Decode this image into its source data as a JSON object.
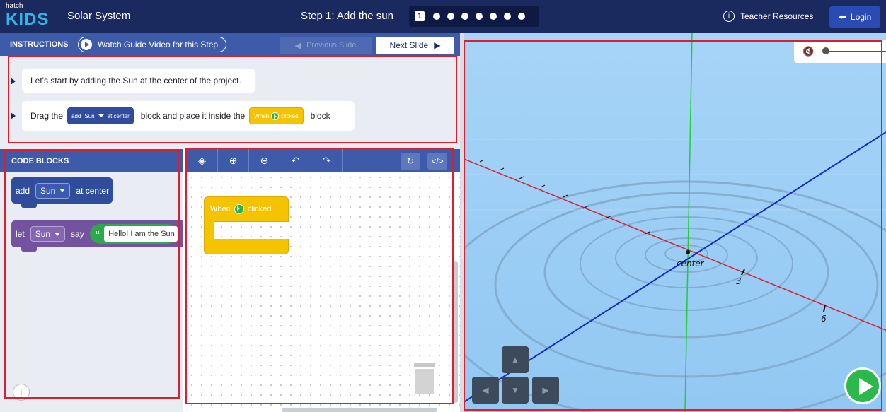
{
  "topbar": {
    "logo_top": "hatch",
    "logo_main": "KIDS",
    "project_title": "Solar System",
    "step_title": "Step 1: Add the sun",
    "current_step": "1",
    "teacher_resources": "Teacher Resources",
    "login": "Login"
  },
  "instructions_bar": {
    "label": "INSTRUCTIONS",
    "watch_video": "Watch Guide Video for this Step",
    "previous": "Previous Slide",
    "next": "Next Slide"
  },
  "instructions": {
    "line1": "Let's start by adding the Sun at the center of the project.",
    "line2_a": "Drag the",
    "line2_b": "block and place it inside the",
    "line2_c": "block",
    "mini_add": "add",
    "mini_sun": "Sun",
    "mini_center": "at center",
    "mini_when": "When",
    "mini_clicked": "clicked"
  },
  "code_blocks": {
    "header": "CODE BLOCKS",
    "add_block": {
      "kw": "add",
      "target": "Sun",
      "suffix": "at center"
    },
    "let_block": {
      "kw": "let",
      "target": "Sun",
      "verb": "say",
      "quote": "“",
      "text": "Hello! I am the Sun"
    }
  },
  "workspace": {
    "when_label": "When",
    "clicked_label": "clicked"
  },
  "stage": {
    "center_label": "center",
    "tick3": "3",
    "tick6": "6"
  },
  "colors": {
    "topbar": "#1b2a5e",
    "panel_blue": "#3d5ba8",
    "block_blue": "#2f4d9b",
    "block_purple": "#7352a0",
    "block_yellow": "#f5c400",
    "run_green": "#2cb84a",
    "stage_bg": "#9fd0f7",
    "annotation_red": "#d82030"
  }
}
